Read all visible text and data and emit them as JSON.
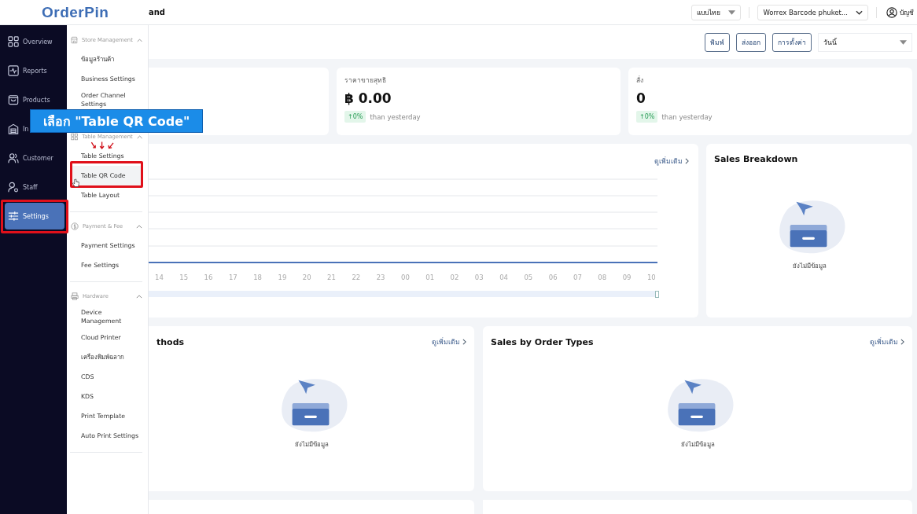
{
  "header": {
    "logo": "OrderPin",
    "page_title": "and",
    "language": "แบบไทย",
    "store": "Worrex Barcode phuket...",
    "account": "บัญชี"
  },
  "nav": [
    {
      "label": "Overview",
      "selected": false
    },
    {
      "label": "Reports",
      "selected": false
    },
    {
      "label": "Products",
      "selected": false
    },
    {
      "label": "In",
      "selected": false
    },
    {
      "label": "Customer",
      "selected": false
    },
    {
      "label": "Staff",
      "selected": false
    },
    {
      "label": "Settings",
      "selected": true
    }
  ],
  "submenu": [
    {
      "title": "Store Management",
      "expanded": true,
      "items": [
        {
          "label": "ข้อมูลร้านค้า",
          "selected": false
        },
        {
          "label": "Business Settings",
          "selected": false
        },
        {
          "label": "Order Channel Settings",
          "selected": false
        }
      ]
    },
    {
      "title": "Table Management",
      "expanded": true,
      "items": [
        {
          "label": "Table Settings",
          "selected": false
        },
        {
          "label": "Table QR Code",
          "selected": true
        },
        {
          "label": "Table Layout",
          "selected": false
        }
      ]
    },
    {
      "title": "Payment & Fee",
      "expanded": true,
      "items": [
        {
          "label": "Payment Settings",
          "selected": false
        },
        {
          "label": "Fee Settings",
          "selected": false
        }
      ]
    },
    {
      "title": "Hardware",
      "expanded": true,
      "items": [
        {
          "label": "Device Management",
          "selected": false
        },
        {
          "label": "Cloud Printer",
          "selected": false
        },
        {
          "label": "เครื่องพิมพ์ฉลาก",
          "selected": false
        },
        {
          "label": "CDS",
          "selected": false
        },
        {
          "label": "KDS",
          "selected": false
        },
        {
          "label": "Print Template",
          "selected": false
        },
        {
          "label": "Auto Print Settings",
          "selected": false
        }
      ]
    }
  ],
  "toolbar": {
    "buttons": [
      "พิมพ์",
      "ส่งออก",
      "การตั้งค่า"
    ],
    "period": "วันนี้"
  },
  "stats": [
    {
      "label": "ราคาขายสุทธิ",
      "value": "฿ 0.00",
      "change": "↑0%",
      "note": "than yesterday"
    },
    {
      "label": "สั่ง",
      "value": "0",
      "change": "↑0%",
      "note": "than yesterday"
    }
  ],
  "sales_chart": {
    "link": "ดูเพิ่มเติม",
    "x_labels": [
      "14",
      "15",
      "16",
      "17",
      "18",
      "19",
      "20",
      "21",
      "22",
      "23",
      "00",
      "01",
      "02",
      "03",
      "04",
      "05",
      "06",
      "07",
      "08",
      "09",
      "10"
    ]
  },
  "breakdown": {
    "title": "Sales Breakdown",
    "empty_text": "ยังไม่มีข้อมูล"
  },
  "panels": [
    {
      "title": "thods",
      "link": "ดูเพิ่มเติม",
      "empty_text": "ยังไม่มีข้อมูล"
    },
    {
      "title": "Sales by Order Types",
      "link": "ดูเพิ่มเติม",
      "empty_text": "ยังไม่มีข้อมูล"
    }
  ],
  "annotation": {
    "label": "เลือก \"Table QR Code\""
  }
}
